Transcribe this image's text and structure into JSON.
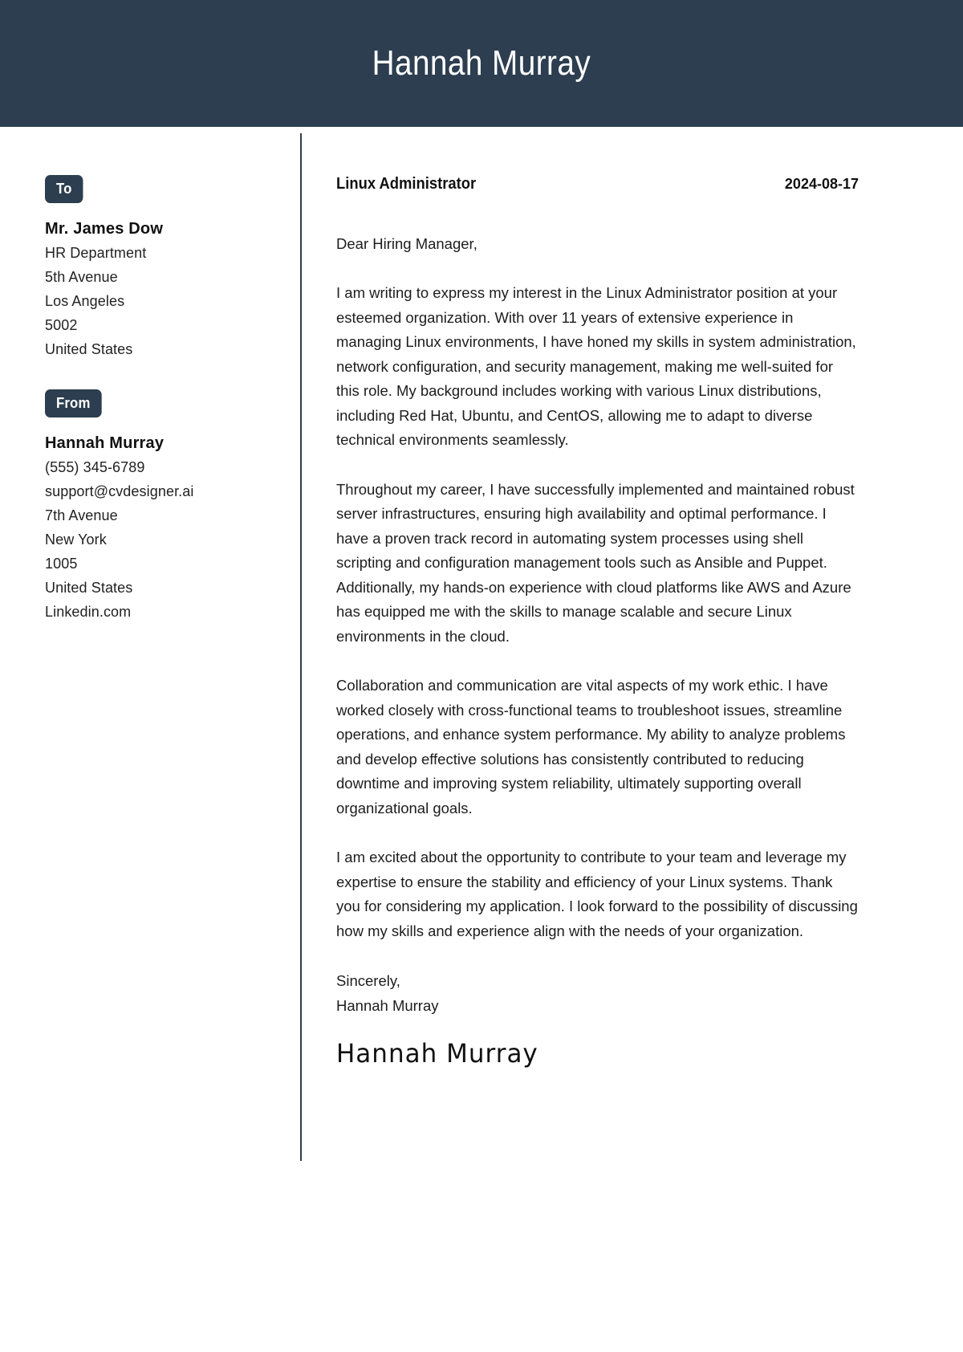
{
  "header": {
    "name": "Hannah Murray",
    "background_color": "#2c3e50",
    "text_color": "#ffffff"
  },
  "sidebar": {
    "to": {
      "badge_label": "To",
      "name": "Mr. James Dow",
      "lines": [
        "HR Department",
        "5th Avenue",
        "Los Angeles",
        "5002",
        "United States"
      ]
    },
    "from": {
      "badge_label": "From",
      "name": "Hannah Murray",
      "lines": [
        "(555) 345-6789",
        "support@cvdesigner.ai",
        "7th Avenue",
        "New York",
        "1005",
        "United States",
        "Linkedin.com"
      ]
    }
  },
  "letter": {
    "job_title": "Linux Administrator",
    "date": "2024-08-17",
    "salutation": "Dear Hiring Manager,",
    "paragraphs": [
      "I am writing to express my interest in the Linux Administrator position at your esteemed organization. With over 11 years of extensive experience in managing Linux environments, I have honed my skills in system administration, network configuration, and security management, making me well-suited for this role. My background includes working with various Linux distributions, including Red Hat, Ubuntu, and CentOS, allowing me to adapt to diverse technical environments seamlessly.",
      "Throughout my career, I have successfully implemented and maintained robust server infrastructures, ensuring high availability and optimal performance. I have a proven track record in automating system processes using shell scripting and configuration management tools such as Ansible and Puppet. Additionally, my hands-on experience with cloud platforms like AWS and Azure has equipped me with the skills to manage scalable and secure Linux environments in the cloud.",
      "Collaboration and communication are vital aspects of my work ethic. I have worked closely with cross-functional teams to troubleshoot issues, streamline operations, and enhance system performance. My ability to analyze problems and develop effective solutions has consistently contributed to reducing downtime and improving system reliability, ultimately supporting overall organizational goals.",
      "I am excited about the opportunity to contribute to your team and leverage my expertise to ensure the stability and efficiency of your Linux systems. Thank you for considering my application. I look forward to the possibility of discussing how my skills and experience align with the needs of your organization."
    ],
    "closing": "Sincerely,",
    "closing_name": "Hannah Murray",
    "signature": "Hannah Murray"
  },
  "colors": {
    "accent": "#2c3e50",
    "body_text": "#1d1d1d",
    "page_background": "#ffffff"
  }
}
